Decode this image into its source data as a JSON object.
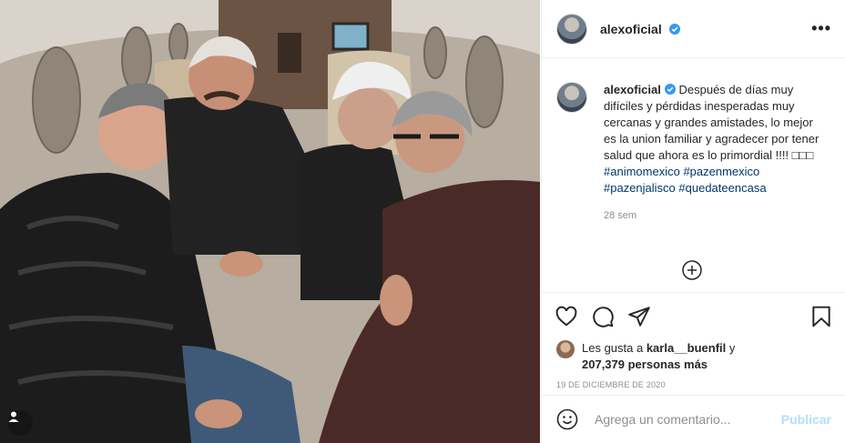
{
  "post": {
    "username": "alexoficial",
    "more_icon": "more-horizontal-icon",
    "verified_icon": "verified-badge-icon",
    "caption": {
      "text": "Después de días muy difíciles y pérdidas inesperadas muy cercanas y grandes amistades, lo mejor es la union familiar y agradecer por tener salud que ahora es lo primordial !!!! ",
      "emoji": "□□□",
      "hashtags": [
        "#animomexico",
        "#pazenmexico",
        "#pazenjalisco",
        "#quedateencasa"
      ]
    },
    "time_ago": "28 sem",
    "load_more_icon": "plus-circle-icon",
    "likes_prefix": "Les gusta a ",
    "liked_by_user": "karla__buenfil",
    "likes_connector": " y",
    "likes_count": "207,379 personas más",
    "date": "19 DE DICIEMBRE DE 2020",
    "comment_placeholder": "Agrega un comentario...",
    "publish_label": "Publicar",
    "actions": [
      "heart-icon",
      "comment-icon",
      "share-icon",
      "bookmark-icon"
    ],
    "colors": {
      "link": "#00376b",
      "verified": "#3897f0",
      "muted": "#8e8e8e",
      "publish_disabled": "#b2dffc"
    }
  }
}
